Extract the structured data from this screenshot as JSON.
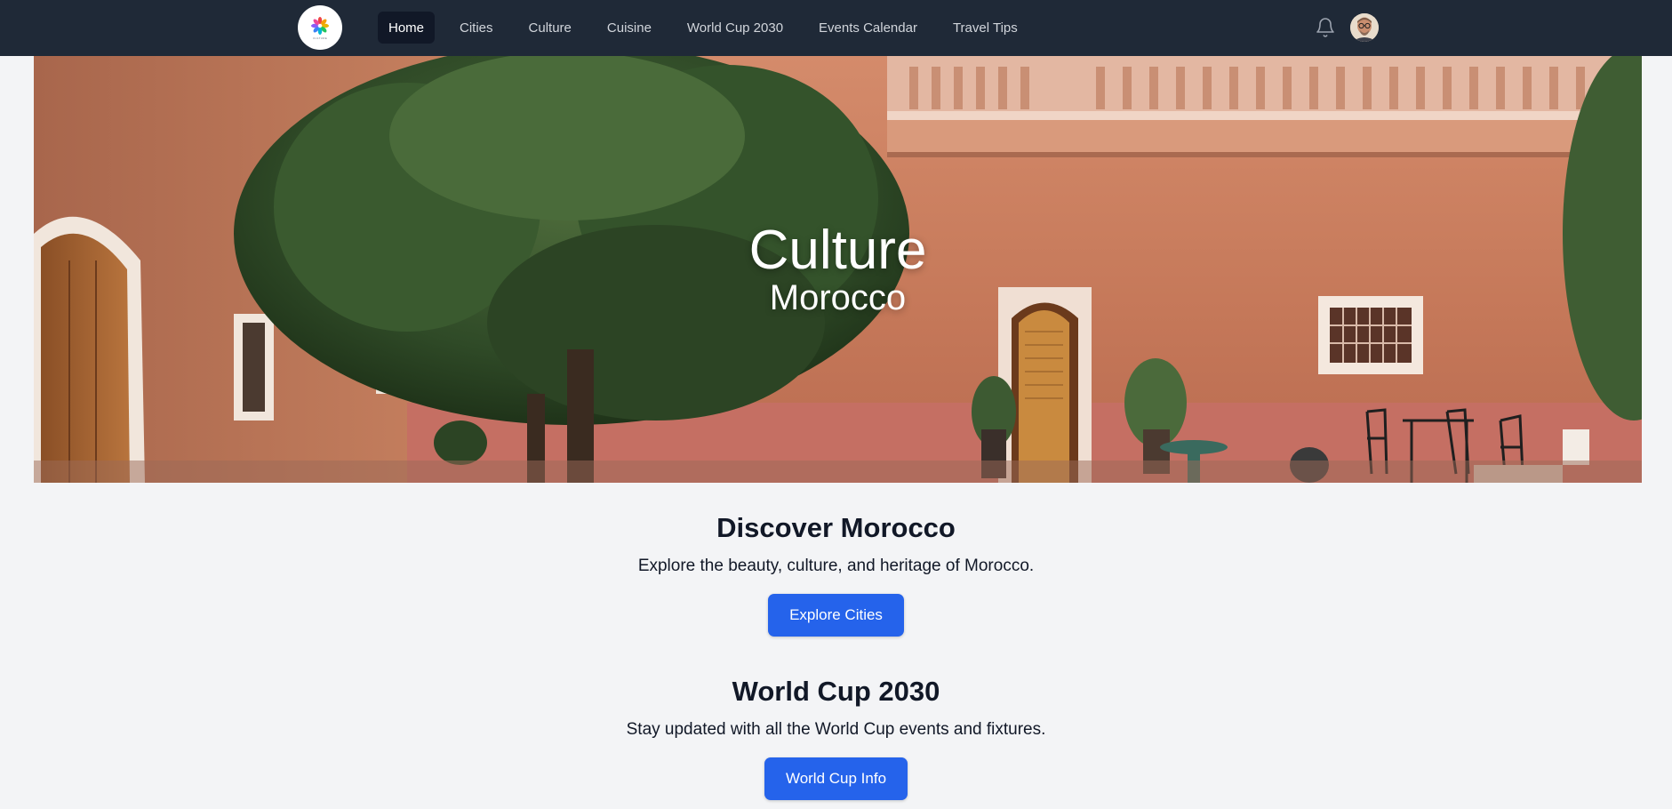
{
  "nav": {
    "logo_text": "CULTURE",
    "links": [
      {
        "label": "Home",
        "active": true
      },
      {
        "label": "Cities",
        "active": false
      },
      {
        "label": "Culture",
        "active": false
      },
      {
        "label": "Cuisine",
        "active": false
      },
      {
        "label": "World Cup 2030",
        "active": false
      },
      {
        "label": "Events Calendar",
        "active": false
      },
      {
        "label": "Travel Tips",
        "active": false
      }
    ],
    "icons": {
      "notifications": "bell-icon",
      "profile": "avatar"
    }
  },
  "hero": {
    "title": "Culture",
    "subtitle": "Morocco"
  },
  "sections": [
    {
      "heading": "Discover Morocco",
      "text": "Explore the beauty, culture, and heritage of Morocco.",
      "button": "Explore Cities"
    },
    {
      "heading": "World Cup 2030",
      "text": "Stay updated with all the World Cup events and fixtures.",
      "button": "World Cup Info"
    }
  ],
  "colors": {
    "nav_bg": "#1f2937",
    "nav_active_bg": "#111827",
    "page_bg": "#f3f4f6",
    "button": "#2563eb",
    "wall": "#c77a5c",
    "tree": "#2f4a2a"
  }
}
